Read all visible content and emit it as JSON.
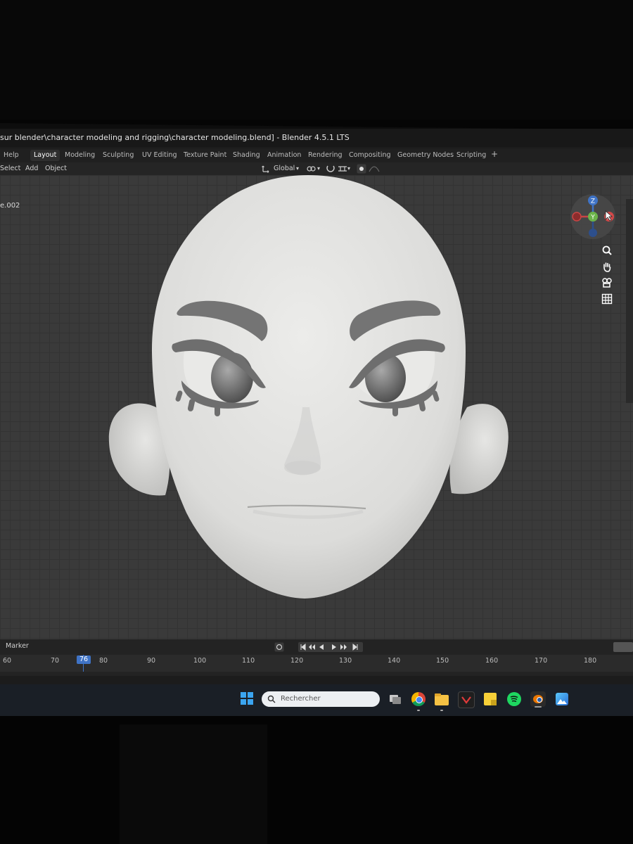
{
  "window": {
    "title": "sur blender\\character modeling and rigging\\character modeling.blend] - Blender 4.5.1 LTS"
  },
  "menu": {
    "help": "Help",
    "select": "Select",
    "add": "Add",
    "object": "Object"
  },
  "workspaces": [
    "Layout",
    "Modeling",
    "Sculpting",
    "UV Editing",
    "Texture Paint",
    "Shading",
    "Animation",
    "Rendering",
    "Compositing",
    "Geometry Nodes",
    "Scripting"
  ],
  "workspace_add": "+",
  "active_workspace": "Layout",
  "header": {
    "orientation": "Global"
  },
  "viewport": {
    "object_name": "e.002"
  },
  "gizmo": {
    "z": "Z",
    "y": "Y",
    "x": "X"
  },
  "timeline": {
    "marker_label": "Marker",
    "current_frame": "76",
    "ticks": [
      "60",
      "70",
      "80",
      "90",
      "100",
      "110",
      "120",
      "130",
      "140",
      "150",
      "160",
      "170",
      "180"
    ]
  },
  "taskbar": {
    "search_placeholder": "Rechercher"
  },
  "colors": {
    "viewport_bg": "#3a3a3a",
    "accent_blue": "#3f73c6",
    "model": "#e3e3e1",
    "eyebrow": "#737373"
  }
}
